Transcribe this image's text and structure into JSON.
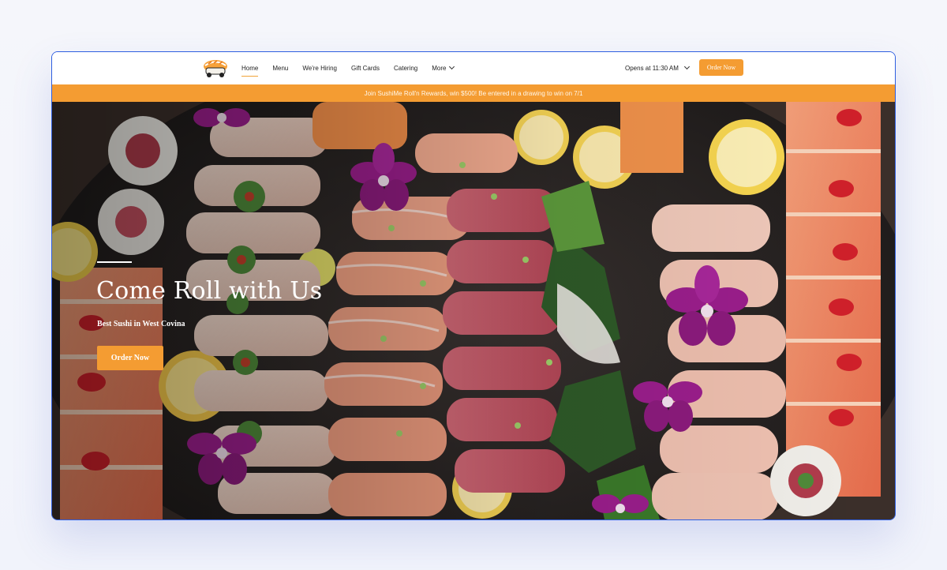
{
  "nav": {
    "logo_name": "sushi-roll-logo",
    "links": [
      {
        "label": "Home",
        "active": true
      },
      {
        "label": "Menu"
      },
      {
        "label": "We're Hiring"
      },
      {
        "label": "Gift Cards"
      },
      {
        "label": "Catering"
      },
      {
        "label": "More"
      }
    ],
    "hours_label": "Opens at 11:30 AM",
    "order_button": "Order Now"
  },
  "banner": {
    "text": "Join SushiMe Roll'n Rewards, win $500! Be entered in a drawing to win on 7/1"
  },
  "hero": {
    "title": "Come Roll with Us",
    "subtitle": "Best Sushi in West Covina",
    "button": "Order Now"
  },
  "colors": {
    "accent": "#f49c32",
    "frame_border": "#2f5fe0"
  }
}
